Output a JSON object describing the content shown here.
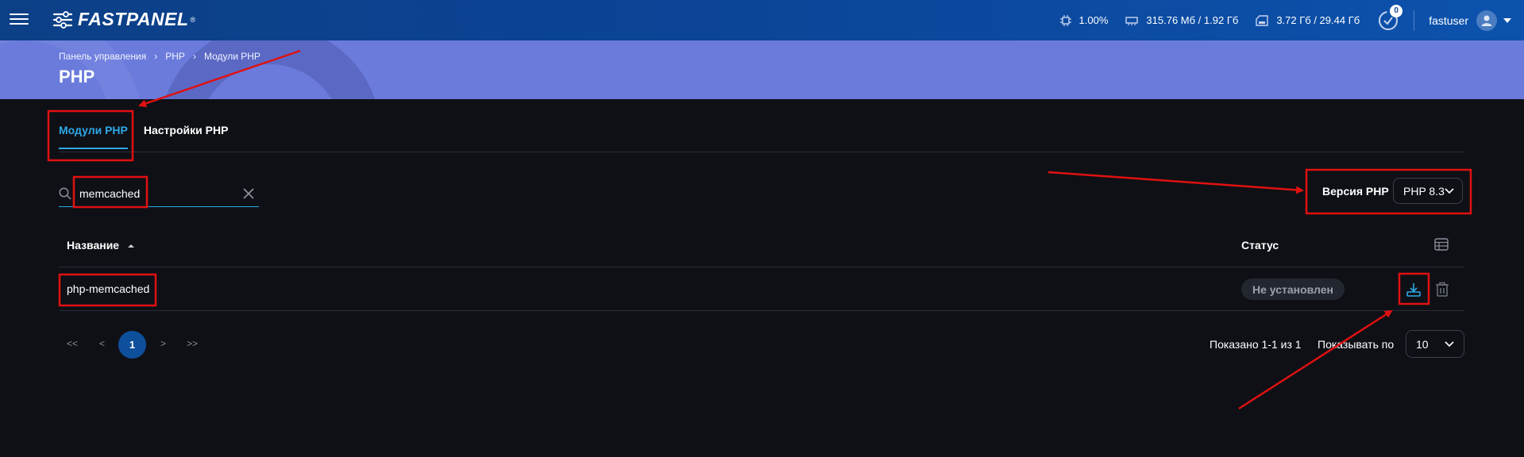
{
  "topbar": {
    "logo_text": "FASTPANEL",
    "logo_reg": "®",
    "cpu": "1.00%",
    "ram": "315.76 Мб / 1.92 Гб",
    "disk": "3.72 Гб / 29.44 Гб",
    "notifications_count": "0",
    "username": "fastuser"
  },
  "breadcrumb": [
    "Панель управления",
    "PHP",
    "Модули PHP"
  ],
  "breadcrumb_separator": "›",
  "page_title": "PHP",
  "tabs": [
    {
      "label": "Модули PHP",
      "active": true
    },
    {
      "label": "Настройки PHP",
      "active": false
    }
  ],
  "search": {
    "value": "memcached",
    "placeholder": ""
  },
  "version": {
    "label": "Версия PHP",
    "selected": "PHP 8.3"
  },
  "table": {
    "columns": {
      "name": "Название",
      "status": "Статус"
    },
    "rows": [
      {
        "name": "php-memcached",
        "status": "Не установлен"
      }
    ]
  },
  "pagination": {
    "first": "<<",
    "prev": "<",
    "current": "1",
    "next": ">",
    "last": ">>"
  },
  "summary": {
    "shown": "Показано 1-1 из 1",
    "per_page_label": "Показывать по",
    "per_page": "10"
  },
  "colors": {
    "accent": "#2ea8e6",
    "topbar": "#0b4496",
    "band": "#6b7bdc",
    "annotation": "#e01010",
    "background": "#0e1016"
  },
  "icons": [
    "menu-icon",
    "cpu-icon",
    "ram-icon",
    "disk-icon",
    "notifications-icon",
    "user-icon",
    "chevron-down-icon",
    "search-icon",
    "close-icon",
    "sort-asc-icon",
    "columns-icon",
    "install-icon",
    "trash-icon"
  ]
}
